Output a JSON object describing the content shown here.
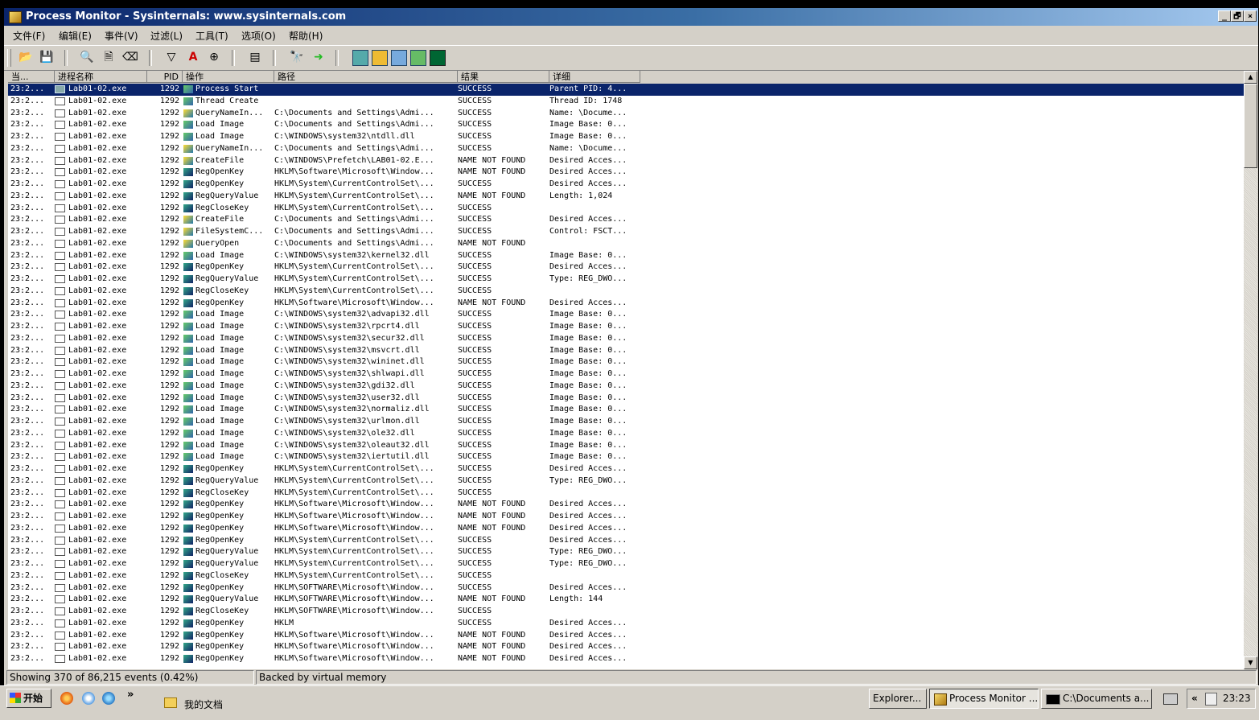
{
  "window": {
    "title": "Process Monitor - Sysinternals: www.sysinternals.com",
    "controls": {
      "minimize": "_",
      "restore": "🗗",
      "close": "×"
    }
  },
  "menu": [
    "文件(F)",
    "编辑(E)",
    "事件(V)",
    "过滤(L)",
    "工具(T)",
    "选项(O)",
    "帮助(H)"
  ],
  "columns": {
    "time": "当...",
    "process": "进程名称",
    "pid": "PID",
    "operation": "操作",
    "path": "路径",
    "result": "结果",
    "detail": "详细"
  },
  "rows": [
    {
      "time": "23:2...",
      "process": "Lab01-02.exe",
      "pid": "1292",
      "operation": "Process Start",
      "path": "",
      "result": "SUCCESS",
      "detail": "Parent PID: 4...",
      "type": "proc",
      "selected": true
    },
    {
      "time": "23:2...",
      "process": "Lab01-02.exe",
      "pid": "1292",
      "operation": "Thread Create",
      "path": "",
      "result": "SUCCESS",
      "detail": "Thread ID: 1748",
      "type": "proc"
    },
    {
      "time": "23:2...",
      "process": "Lab01-02.exe",
      "pid": "1292",
      "operation": "QueryNameIn...",
      "path": "C:\\Documents and Settings\\Admi...",
      "result": "SUCCESS",
      "detail": "Name: \\Docume...",
      "type": "file"
    },
    {
      "time": "23:2...",
      "process": "Lab01-02.exe",
      "pid": "1292",
      "operation": "Load Image",
      "path": "C:\\Documents and Settings\\Admi...",
      "result": "SUCCESS",
      "detail": "Image Base: 0...",
      "type": "proc"
    },
    {
      "time": "23:2...",
      "process": "Lab01-02.exe",
      "pid": "1292",
      "operation": "Load Image",
      "path": "C:\\WINDOWS\\system32\\ntdll.dll",
      "result": "SUCCESS",
      "detail": "Image Base: 0...",
      "type": "proc"
    },
    {
      "time": "23:2...",
      "process": "Lab01-02.exe",
      "pid": "1292",
      "operation": "QueryNameIn...",
      "path": "C:\\Documents and Settings\\Admi...",
      "result": "SUCCESS",
      "detail": "Name: \\Docume...",
      "type": "file"
    },
    {
      "time": "23:2...",
      "process": "Lab01-02.exe",
      "pid": "1292",
      "operation": "CreateFile",
      "path": "C:\\WINDOWS\\Prefetch\\LAB01-02.E...",
      "result": "NAME NOT FOUND",
      "detail": "Desired Acces...",
      "type": "file"
    },
    {
      "time": "23:2...",
      "process": "Lab01-02.exe",
      "pid": "1292",
      "operation": "RegOpenKey",
      "path": "HKLM\\Software\\Microsoft\\Window...",
      "result": "NAME NOT FOUND",
      "detail": "Desired Acces...",
      "type": "reg"
    },
    {
      "time": "23:2...",
      "process": "Lab01-02.exe",
      "pid": "1292",
      "operation": "RegOpenKey",
      "path": "HKLM\\System\\CurrentControlSet\\...",
      "result": "SUCCESS",
      "detail": "Desired Acces...",
      "type": "reg"
    },
    {
      "time": "23:2...",
      "process": "Lab01-02.exe",
      "pid": "1292",
      "operation": "RegQueryValue",
      "path": "HKLM\\System\\CurrentControlSet\\...",
      "result": "NAME NOT FOUND",
      "detail": "Length: 1,024",
      "type": "reg"
    },
    {
      "time": "23:2...",
      "process": "Lab01-02.exe",
      "pid": "1292",
      "operation": "RegCloseKey",
      "path": "HKLM\\System\\CurrentControlSet\\...",
      "result": "SUCCESS",
      "detail": "",
      "type": "reg"
    },
    {
      "time": "23:2...",
      "process": "Lab01-02.exe",
      "pid": "1292",
      "operation": "CreateFile",
      "path": "C:\\Documents and Settings\\Admi...",
      "result": "SUCCESS",
      "detail": "Desired Acces...",
      "type": "file"
    },
    {
      "time": "23:2...",
      "process": "Lab01-02.exe",
      "pid": "1292",
      "operation": "FileSystemC...",
      "path": "C:\\Documents and Settings\\Admi...",
      "result": "SUCCESS",
      "detail": "Control: FSCT...",
      "type": "file"
    },
    {
      "time": "23:2...",
      "process": "Lab01-02.exe",
      "pid": "1292",
      "operation": "QueryOpen",
      "path": "C:\\Documents and Settings\\Admi...",
      "result": "NAME NOT FOUND",
      "detail": "",
      "type": "file"
    },
    {
      "time": "23:2...",
      "process": "Lab01-02.exe",
      "pid": "1292",
      "operation": "Load Image",
      "path": "C:\\WINDOWS\\system32\\kernel32.dll",
      "result": "SUCCESS",
      "detail": "Image Base: 0...",
      "type": "proc"
    },
    {
      "time": "23:2...",
      "process": "Lab01-02.exe",
      "pid": "1292",
      "operation": "RegOpenKey",
      "path": "HKLM\\System\\CurrentControlSet\\...",
      "result": "SUCCESS",
      "detail": "Desired Acces...",
      "type": "reg"
    },
    {
      "time": "23:2...",
      "process": "Lab01-02.exe",
      "pid": "1292",
      "operation": "RegQueryValue",
      "path": "HKLM\\System\\CurrentControlSet\\...",
      "result": "SUCCESS",
      "detail": "Type: REG_DWO...",
      "type": "reg"
    },
    {
      "time": "23:2...",
      "process": "Lab01-02.exe",
      "pid": "1292",
      "operation": "RegCloseKey",
      "path": "HKLM\\System\\CurrentControlSet\\...",
      "result": "SUCCESS",
      "detail": "",
      "type": "reg"
    },
    {
      "time": "23:2...",
      "process": "Lab01-02.exe",
      "pid": "1292",
      "operation": "RegOpenKey",
      "path": "HKLM\\Software\\Microsoft\\Window...",
      "result": "NAME NOT FOUND",
      "detail": "Desired Acces...",
      "type": "reg"
    },
    {
      "time": "23:2...",
      "process": "Lab01-02.exe",
      "pid": "1292",
      "operation": "Load Image",
      "path": "C:\\WINDOWS\\system32\\advapi32.dll",
      "result": "SUCCESS",
      "detail": "Image Base: 0...",
      "type": "proc"
    },
    {
      "time": "23:2...",
      "process": "Lab01-02.exe",
      "pid": "1292",
      "operation": "Load Image",
      "path": "C:\\WINDOWS\\system32\\rpcrt4.dll",
      "result": "SUCCESS",
      "detail": "Image Base: 0...",
      "type": "proc"
    },
    {
      "time": "23:2...",
      "process": "Lab01-02.exe",
      "pid": "1292",
      "operation": "Load Image",
      "path": "C:\\WINDOWS\\system32\\secur32.dll",
      "result": "SUCCESS",
      "detail": "Image Base: 0...",
      "type": "proc"
    },
    {
      "time": "23:2...",
      "process": "Lab01-02.exe",
      "pid": "1292",
      "operation": "Load Image",
      "path": "C:\\WINDOWS\\system32\\msvcrt.dll",
      "result": "SUCCESS",
      "detail": "Image Base: 0...",
      "type": "proc"
    },
    {
      "time": "23:2...",
      "process": "Lab01-02.exe",
      "pid": "1292",
      "operation": "Load Image",
      "path": "C:\\WINDOWS\\system32\\wininet.dll",
      "result": "SUCCESS",
      "detail": "Image Base: 0...",
      "type": "proc"
    },
    {
      "time": "23:2...",
      "process": "Lab01-02.exe",
      "pid": "1292",
      "operation": "Load Image",
      "path": "C:\\WINDOWS\\system32\\shlwapi.dll",
      "result": "SUCCESS",
      "detail": "Image Base: 0...",
      "type": "proc"
    },
    {
      "time": "23:2...",
      "process": "Lab01-02.exe",
      "pid": "1292",
      "operation": "Load Image",
      "path": "C:\\WINDOWS\\system32\\gdi32.dll",
      "result": "SUCCESS",
      "detail": "Image Base: 0...",
      "type": "proc"
    },
    {
      "time": "23:2...",
      "process": "Lab01-02.exe",
      "pid": "1292",
      "operation": "Load Image",
      "path": "C:\\WINDOWS\\system32\\user32.dll",
      "result": "SUCCESS",
      "detail": "Image Base: 0...",
      "type": "proc"
    },
    {
      "time": "23:2...",
      "process": "Lab01-02.exe",
      "pid": "1292",
      "operation": "Load Image",
      "path": "C:\\WINDOWS\\system32\\normaliz.dll",
      "result": "SUCCESS",
      "detail": "Image Base: 0...",
      "type": "proc"
    },
    {
      "time": "23:2...",
      "process": "Lab01-02.exe",
      "pid": "1292",
      "operation": "Load Image",
      "path": "C:\\WINDOWS\\system32\\urlmon.dll",
      "result": "SUCCESS",
      "detail": "Image Base: 0...",
      "type": "proc"
    },
    {
      "time": "23:2...",
      "process": "Lab01-02.exe",
      "pid": "1292",
      "operation": "Load Image",
      "path": "C:\\WINDOWS\\system32\\ole32.dll",
      "result": "SUCCESS",
      "detail": "Image Base: 0...",
      "type": "proc"
    },
    {
      "time": "23:2...",
      "process": "Lab01-02.exe",
      "pid": "1292",
      "operation": "Load Image",
      "path": "C:\\WINDOWS\\system32\\oleaut32.dll",
      "result": "SUCCESS",
      "detail": "Image Base: 0...",
      "type": "proc"
    },
    {
      "time": "23:2...",
      "process": "Lab01-02.exe",
      "pid": "1292",
      "operation": "Load Image",
      "path": "C:\\WINDOWS\\system32\\iertutil.dll",
      "result": "SUCCESS",
      "detail": "Image Base: 0...",
      "type": "proc"
    },
    {
      "time": "23:2...",
      "process": "Lab01-02.exe",
      "pid": "1292",
      "operation": "RegOpenKey",
      "path": "HKLM\\System\\CurrentControlSet\\...",
      "result": "SUCCESS",
      "detail": "Desired Acces...",
      "type": "reg"
    },
    {
      "time": "23:2...",
      "process": "Lab01-02.exe",
      "pid": "1292",
      "operation": "RegQueryValue",
      "path": "HKLM\\System\\CurrentControlSet\\...",
      "result": "SUCCESS",
      "detail": "Type: REG_DWO...",
      "type": "reg"
    },
    {
      "time": "23:2...",
      "process": "Lab01-02.exe",
      "pid": "1292",
      "operation": "RegCloseKey",
      "path": "HKLM\\System\\CurrentControlSet\\...",
      "result": "SUCCESS",
      "detail": "",
      "type": "reg"
    },
    {
      "time": "23:2...",
      "process": "Lab01-02.exe",
      "pid": "1292",
      "operation": "RegOpenKey",
      "path": "HKLM\\Software\\Microsoft\\Window...",
      "result": "NAME NOT FOUND",
      "detail": "Desired Acces...",
      "type": "reg"
    },
    {
      "time": "23:2...",
      "process": "Lab01-02.exe",
      "pid": "1292",
      "operation": "RegOpenKey",
      "path": "HKLM\\Software\\Microsoft\\Window...",
      "result": "NAME NOT FOUND",
      "detail": "Desired Acces...",
      "type": "reg"
    },
    {
      "time": "23:2...",
      "process": "Lab01-02.exe",
      "pid": "1292",
      "operation": "RegOpenKey",
      "path": "HKLM\\Software\\Microsoft\\Window...",
      "result": "NAME NOT FOUND",
      "detail": "Desired Acces...",
      "type": "reg"
    },
    {
      "time": "23:2...",
      "process": "Lab01-02.exe",
      "pid": "1292",
      "operation": "RegOpenKey",
      "path": "HKLM\\System\\CurrentControlSet\\...",
      "result": "SUCCESS",
      "detail": "Desired Acces...",
      "type": "reg"
    },
    {
      "time": "23:2...",
      "process": "Lab01-02.exe",
      "pid": "1292",
      "operation": "RegQueryValue",
      "path": "HKLM\\System\\CurrentControlSet\\...",
      "result": "SUCCESS",
      "detail": "Type: REG_DWO...",
      "type": "reg"
    },
    {
      "time": "23:2...",
      "process": "Lab01-02.exe",
      "pid": "1292",
      "operation": "RegQueryValue",
      "path": "HKLM\\System\\CurrentControlSet\\...",
      "result": "SUCCESS",
      "detail": "Type: REG_DWO...",
      "type": "reg"
    },
    {
      "time": "23:2...",
      "process": "Lab01-02.exe",
      "pid": "1292",
      "operation": "RegCloseKey",
      "path": "HKLM\\System\\CurrentControlSet\\...",
      "result": "SUCCESS",
      "detail": "",
      "type": "reg"
    },
    {
      "time": "23:2...",
      "process": "Lab01-02.exe",
      "pid": "1292",
      "operation": "RegOpenKey",
      "path": "HKLM\\SOFTWARE\\Microsoft\\Window...",
      "result": "SUCCESS",
      "detail": "Desired Acces...",
      "type": "reg"
    },
    {
      "time": "23:2...",
      "process": "Lab01-02.exe",
      "pid": "1292",
      "operation": "RegQueryValue",
      "path": "HKLM\\SOFTWARE\\Microsoft\\Window...",
      "result": "NAME NOT FOUND",
      "detail": "Length: 144",
      "type": "reg"
    },
    {
      "time": "23:2...",
      "process": "Lab01-02.exe",
      "pid": "1292",
      "operation": "RegCloseKey",
      "path": "HKLM\\SOFTWARE\\Microsoft\\Window...",
      "result": "SUCCESS",
      "detail": "",
      "type": "reg"
    },
    {
      "time": "23:2...",
      "process": "Lab01-02.exe",
      "pid": "1292",
      "operation": "RegOpenKey",
      "path": "HKLM",
      "result": "SUCCESS",
      "detail": "Desired Acces...",
      "type": "reg"
    },
    {
      "time": "23:2...",
      "process": "Lab01-02.exe",
      "pid": "1292",
      "operation": "RegOpenKey",
      "path": "HKLM\\Software\\Microsoft\\Window...",
      "result": "NAME NOT FOUND",
      "detail": "Desired Acces...",
      "type": "reg"
    },
    {
      "time": "23:2...",
      "process": "Lab01-02.exe",
      "pid": "1292",
      "operation": "RegOpenKey",
      "path": "HKLM\\Software\\Microsoft\\Window...",
      "result": "NAME NOT FOUND",
      "detail": "Desired Acces...",
      "type": "reg"
    },
    {
      "time": "23:2...",
      "process": "Lab01-02.exe",
      "pid": "1292",
      "operation": "RegOpenKey",
      "path": "HKLM\\Software\\Microsoft\\Window...",
      "result": "NAME NOT FOUND",
      "detail": "Desired Acces...",
      "type": "reg"
    }
  ],
  "status": {
    "events": "Showing 370 of 86,215 events (0.42%)",
    "backing": "Backed by virtual memory"
  },
  "taskbar": {
    "start": "开始",
    "more": "»",
    "desktop_item": "我的文档",
    "buttons": [
      "Explorer...",
      "Process Monitor ...",
      "C:\\Documents a..."
    ],
    "tray_chevron": "«",
    "clock": "23:23"
  },
  "colors": {
    "selection": "#0a246a",
    "titlebar": "#0a246a",
    "chrome": "#d4d0c8"
  }
}
